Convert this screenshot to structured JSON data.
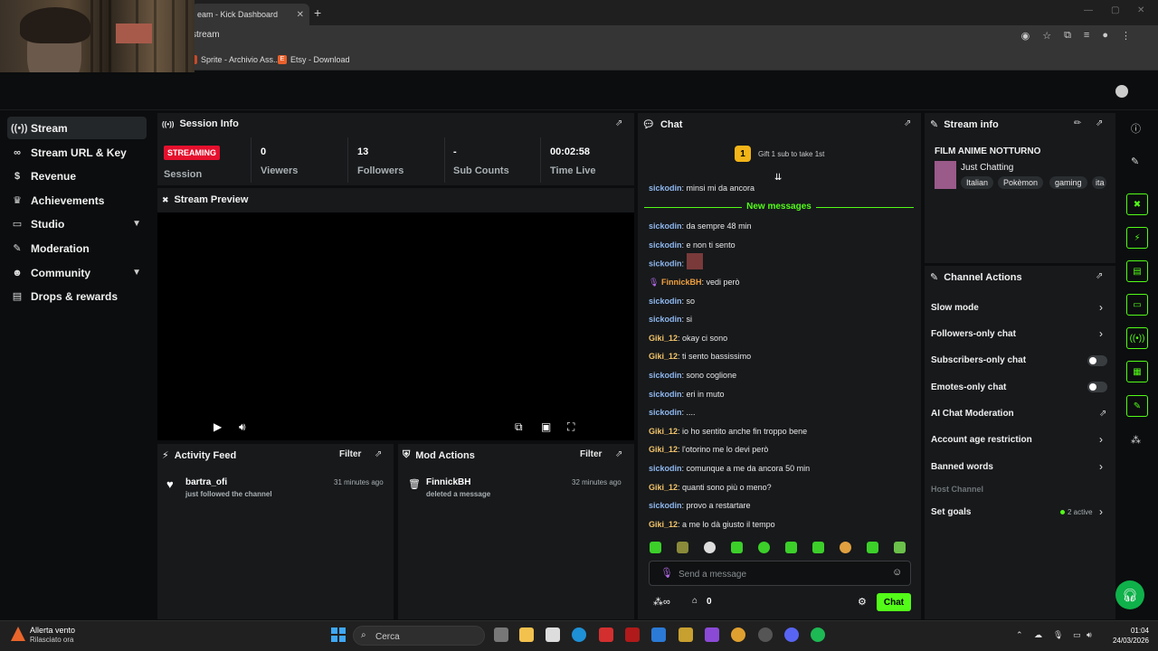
{
  "browser": {
    "tab_title": "eam - Kick Dashboard",
    "address": "stream",
    "bookmarks": [
      "Sprite - Archivio Ass...",
      "Etsy - Download"
    ]
  },
  "sidebar": {
    "items": [
      {
        "label": "Stream",
        "icon": "broadcast-icon",
        "active": true
      },
      {
        "label": "Stream URL & Key",
        "icon": "link-icon"
      },
      {
        "label": "Revenue",
        "icon": "dollar-icon"
      },
      {
        "label": "Achievements",
        "icon": "trophy-icon"
      },
      {
        "label": "Studio",
        "icon": "studio-icon",
        "expandable": true
      },
      {
        "label": "Moderation",
        "icon": "wrench-icon"
      },
      {
        "label": "Community",
        "icon": "people-icon",
        "expandable": true
      },
      {
        "label": "Drops & rewards",
        "icon": "gift-icon"
      }
    ]
  },
  "session": {
    "title": "Session Info",
    "status_badge": "STREAMING",
    "status_label": "Session",
    "stats": [
      {
        "value": "0",
        "label": "Viewers"
      },
      {
        "value": "13",
        "label": "Followers"
      },
      {
        "value": "-",
        "label": "Sub Counts"
      },
      {
        "value": "00:02:58",
        "label": "Time Live"
      }
    ]
  },
  "preview": {
    "title": "Stream Preview"
  },
  "activity": {
    "title": "Activity Feed",
    "filter": "Filter",
    "items": [
      {
        "name": "bartra_ofi",
        "action": "just followed the channel",
        "time": "31 minutes ago"
      }
    ]
  },
  "mod_actions": {
    "title": "Mod Actions",
    "filter": "Filter",
    "items": [
      {
        "name": "FinnickBH",
        "action": "deleted a message",
        "time": "32 minutes ago"
      }
    ]
  },
  "chat": {
    "title": "Chat",
    "gift_badge": "1",
    "gift_text": "Gift 1 sub to take 1st",
    "new_messages": "New messages",
    "messages": [
      {
        "user": "sickodin",
        "sep": ": ",
        "text": "minsi mi da ancora",
        "color": "blue"
      },
      {
        "user": "sickodin",
        "sep": ": ",
        "text": "da sempre 48 min",
        "color": "blue"
      },
      {
        "user": "sickodin",
        "sep": ": ",
        "text": "e non ti sento",
        "color": "blue"
      },
      {
        "user": "sickodin",
        "sep": ": ",
        "text": "",
        "color": "blue",
        "emote": true
      },
      {
        "user": "FinnickBH",
        "sep": ": ",
        "text": "vedi però",
        "color": "orange",
        "mod": true
      },
      {
        "user": "sickodin",
        "sep": ": ",
        "text": "so",
        "color": "blue"
      },
      {
        "user": "sickodin",
        "sep": ": ",
        "text": "si",
        "color": "blue"
      },
      {
        "user": "Giki_12",
        "sep": ": ",
        "text": "okay ci sono",
        "color": "yellow"
      },
      {
        "user": "Giki_12",
        "sep": ": ",
        "text": "ti sento bassissimo",
        "color": "yellow"
      },
      {
        "user": "sickodin",
        "sep": ": ",
        "text": "sono coglione",
        "color": "blue"
      },
      {
        "user": "sickodin",
        "sep": ": ",
        "text": "eri in muto",
        "color": "blue"
      },
      {
        "user": "sickodin",
        "sep": ": ",
        "text": "....",
        "color": "blue"
      },
      {
        "user": "Giki_12",
        "sep": ": ",
        "text": "io ho sentito anche fin troppo bene",
        "color": "yellow"
      },
      {
        "user": "Giki_12",
        "sep": ": ",
        "text": "l'otorino me lo devi però",
        "color": "yellow"
      },
      {
        "user": "sickodin",
        "sep": ": ",
        "text": "comunque a me da ancora 50 min",
        "color": "blue"
      },
      {
        "user": "Giki_12",
        "sep": ": ",
        "text": "quanti sono più o meno?",
        "color": "yellow"
      },
      {
        "user": "sickodin",
        "sep": ": ",
        "text": "provo a restartare",
        "color": "blue"
      },
      {
        "user": "Giki_12",
        "sep": ": ",
        "text": "a me lo dà giusto il tempo",
        "color": "yellow"
      }
    ],
    "input_placeholder": "Send a message",
    "viewer_count": "0",
    "send_label": "Chat"
  },
  "stream_info": {
    "title": "Stream info",
    "stream_title": "FILM ANIME NOTTURNO",
    "category": "Just Chatting",
    "tags": [
      "Italian",
      "Pokèmon",
      "gaming",
      "ita"
    ]
  },
  "channel_actions": {
    "title": "Channel Actions",
    "items": [
      {
        "label": "Slow mode",
        "control": "chevron"
      },
      {
        "label": "Followers-only chat",
        "control": "chevron"
      },
      {
        "label": "Subscribers-only chat",
        "control": "toggle"
      },
      {
        "label": "Emotes-only chat",
        "control": "toggle"
      },
      {
        "label": "AI Chat Moderation",
        "control": "external"
      },
      {
        "label": "Account age restriction",
        "control": "chevron"
      },
      {
        "label": "Banned words",
        "control": "chevron"
      },
      {
        "label": "Host Channel",
        "control": "none",
        "disabled": true
      },
      {
        "label": "Set goals",
        "control": "chevron",
        "status": "2 active"
      }
    ]
  },
  "taskbar": {
    "alert_title": "Allerta vento",
    "alert_sub": "Rilasciato ora",
    "search_placeholder": "Cerca",
    "time": "01:04",
    "date": "24/03/2026"
  },
  "colors": {
    "accent": "#53fc18",
    "live": "#e5102d"
  }
}
